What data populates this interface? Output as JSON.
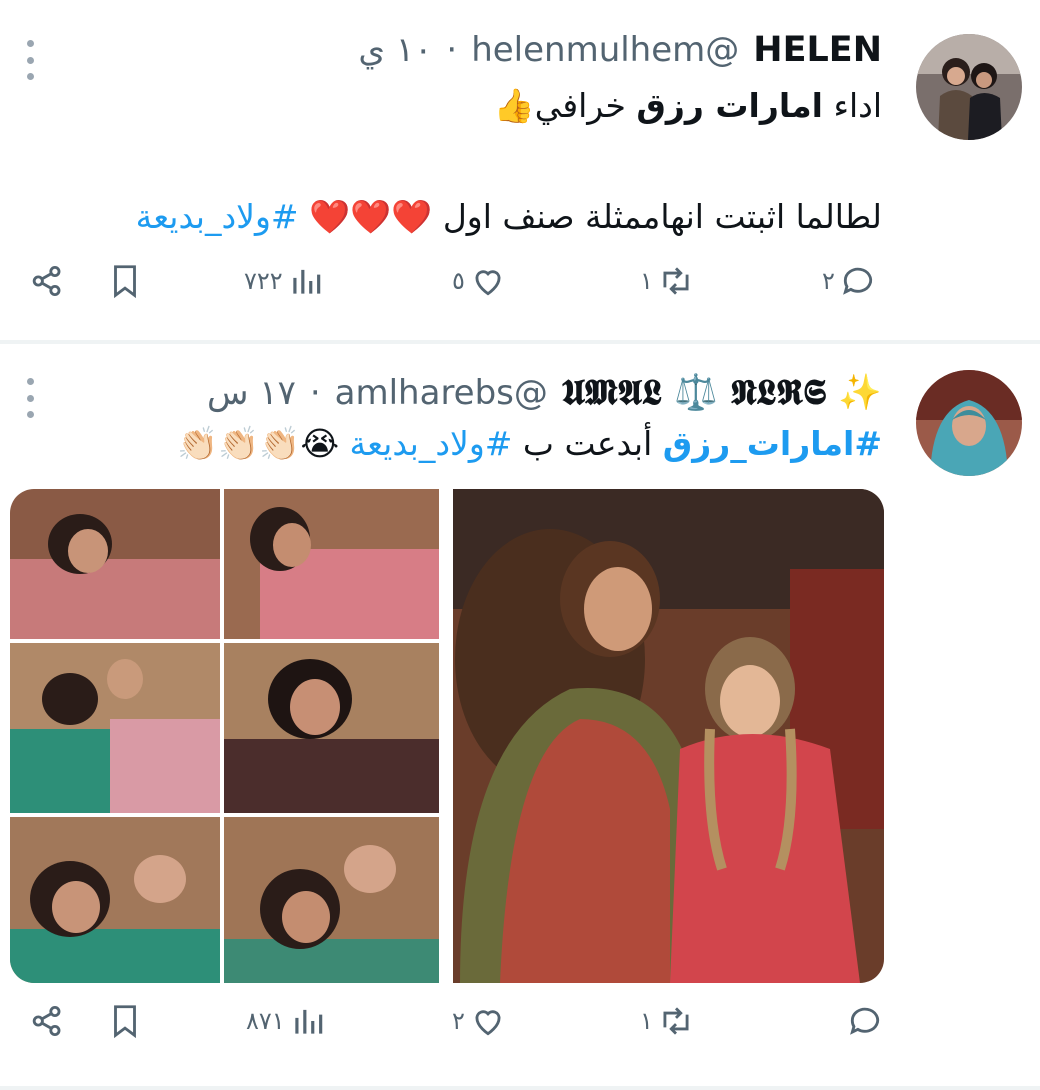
{
  "tweets": [
    {
      "name": "HELEN",
      "handle": "@helenmulhem",
      "time": "١٠ ي",
      "line1_prefix": "اداء ",
      "line1_bold": "امارات رزق",
      "line1_suffix": " خرافي👍",
      "line2_text": "لطالما اثبتت انهاممثلة صنف اول ❤️❤️❤️ ",
      "line2_hashtag": "#ولاد_بديعة",
      "replies": "٢",
      "retweets": "١",
      "likes": "٥",
      "views": "٧٢٢"
    },
    {
      "name": "✨ 𝖀𝕸𝕬𝕷 ⚖️ 𝕹𝕷𝕽𝕾",
      "handle": "@amlharebs",
      "time": "١٧ س",
      "text_hashtag1": "#امارات_رزق",
      "text_mid": " أبدعت ب ",
      "text_hashtag2": "#ولاد_بديعة",
      "text_emoji": " 😭👏🏻👏🏻👏🏻",
      "replies": "",
      "retweets": "١",
      "likes": "٢",
      "views": "٨٧١"
    }
  ],
  "icons": [
    "reply-icon",
    "retweet-icon",
    "like-icon",
    "views-icon",
    "bookmark-icon",
    "share-icon",
    "more-icon"
  ],
  "colors": {
    "accent": "#1d9bf0",
    "muted": "#536471",
    "separator": "#eff3f4"
  }
}
